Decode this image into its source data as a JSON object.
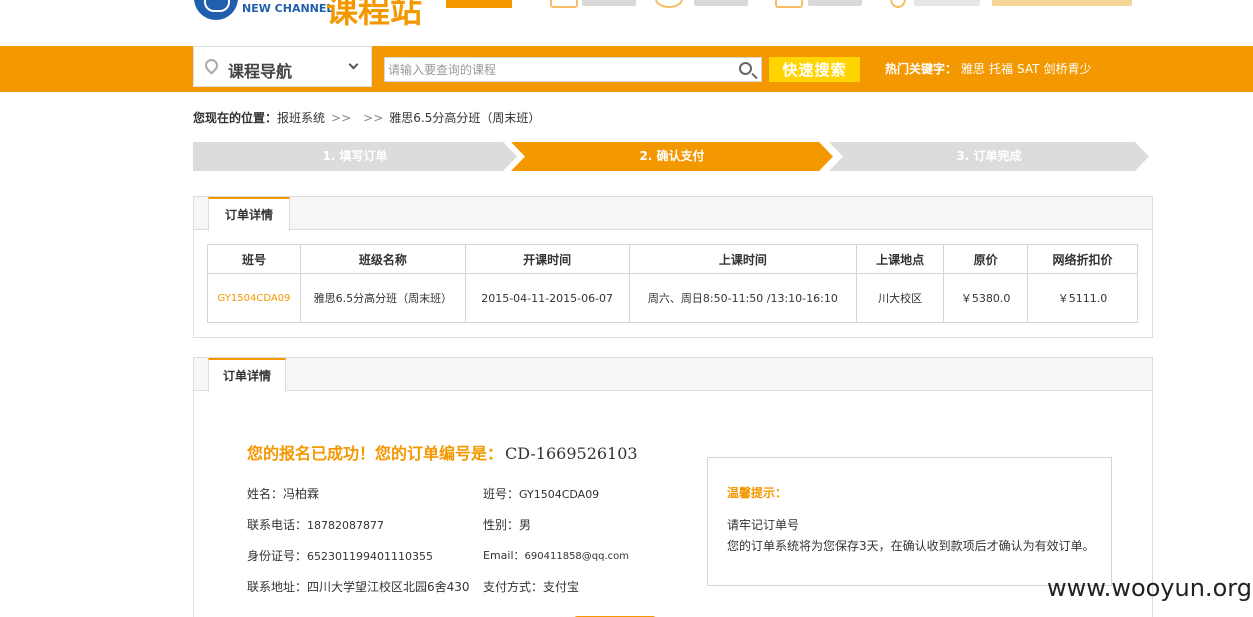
{
  "header": {
    "logo_en": "NEW CHANNEL",
    "logo_cn": "课程站"
  },
  "nav": {
    "course_nav_label": "课程导航",
    "search_placeholder": "请输入要查询的课程",
    "search_button": "快速搜索",
    "hot_label": "热门关键字：",
    "hot_keywords": [
      "雅思",
      "托福",
      "SAT",
      "剑桥青少"
    ]
  },
  "breadcrumb": {
    "prefix": "您现在的位置：",
    "items": [
      "报班系统",
      "",
      "雅思6.5分高分班（周末班）"
    ],
    "separator": ">>"
  },
  "steps": [
    "1. 填写订单",
    "2. 确认支付",
    "3. 订单完成"
  ],
  "order_panel": {
    "tab": "订单详情",
    "columns": [
      "班号",
      "班级名称",
      "开课时间",
      "上课时间",
      "上课地点",
      "原价",
      "网络折扣价"
    ],
    "rows": [
      [
        "GY1504CDA09",
        "雅思6.5分高分班（周末班）",
        "2015-04-11-2015-06-07",
        "周六、周日8:50-11:50 /13:10-16:10",
        "川大校区",
        "￥5380.0",
        "￥5111.0"
      ]
    ]
  },
  "confirm_panel": {
    "tab": "订单详情",
    "success_text": "您的报名已成功！您的订单编号是：",
    "order_id": "CD-1669526103",
    "fields": {
      "name_label": "姓名：",
      "name": "冯柏霖",
      "class_label": "班号：",
      "class_no": "GY1504CDA09",
      "phone_label": "联系电话：",
      "phone": "18782087877",
      "gender_label": "性别：",
      "gender": "男",
      "id_label": "身份证号：",
      "id_no": "652301199401110355",
      "email_label": "Email：",
      "email": "690411858@qq.com",
      "address_label": "联系地址：",
      "address": "四川大学望江校区北园6舍430",
      "pay_label": "支付方式：",
      "pay": "支付宝"
    },
    "tip_title": "温馨提示：",
    "tip_line1": "请牢记订单号",
    "tip_line2": "您的订单系统将为您保存3天，在确认收到款项后才确认为有效订单。"
  },
  "watermark": "www.wooyun.org",
  "colors": {
    "accent": "#f39800",
    "brand_blue": "#1f5fae",
    "button_yellow": "#ffd400"
  }
}
